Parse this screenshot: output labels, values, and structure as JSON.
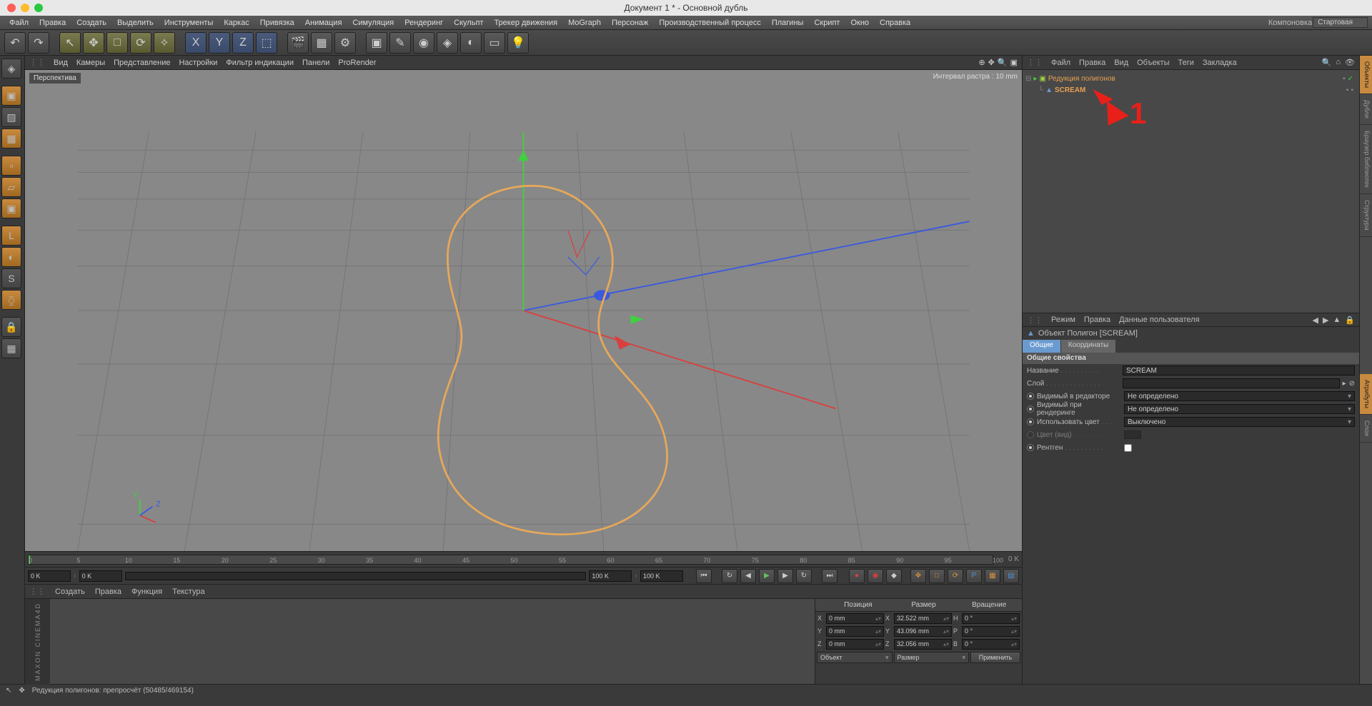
{
  "title": "Документ 1 * - Основной дубль",
  "menu": [
    "Файл",
    "Правка",
    "Создать",
    "Выделить",
    "Инструменты",
    "Каркас",
    "Привязка",
    "Анимация",
    "Симуляция",
    "Рендеринг",
    "Скульпт",
    "Трекер движения",
    "MoGraph",
    "Персонаж",
    "Производственный процесс",
    "Плагины",
    "Скрипт",
    "Окно",
    "Справка"
  ],
  "layout_label": "Компоновка",
  "layout_value": "Стартовая",
  "vp_menu": [
    "Вид",
    "Камеры",
    "Представление",
    "Настройки",
    "Фильтр индикации",
    "Панели",
    "ProRender"
  ],
  "vp_label": "Перспектива",
  "vp_grid": "Интервал растра : 10 mm",
  "timeline": {
    "start": "0 K",
    "end": "100 K",
    "ticks": [
      0,
      5,
      10,
      15,
      20,
      25,
      30,
      35,
      40,
      45,
      50,
      55,
      60,
      65,
      70,
      75,
      80,
      85,
      90,
      95,
      100
    ],
    "endlabel": "0 K"
  },
  "play": {
    "l1": "0 K",
    "l2": "0 K",
    "r1": "100 K",
    "r2": "100 K"
  },
  "mat_menu": [
    "Создать",
    "Правка",
    "Функция",
    "Текстура"
  ],
  "coord": {
    "heads": [
      "Позиция",
      "Размер",
      "Вращение"
    ],
    "rows": [
      {
        "a": "X",
        "p": "0 mm",
        "s": "32.522 mm",
        "ra": "H",
        "r": "0 °"
      },
      {
        "a": "Y",
        "p": "0 mm",
        "s": "43.096 mm",
        "ra": "P",
        "r": "0 °"
      },
      {
        "a": "Z",
        "p": "0 mm",
        "s": "32.056 mm",
        "ra": "B",
        "r": "0 °"
      }
    ],
    "dd1": "Объект",
    "dd2": "Размер",
    "btn": "Применить"
  },
  "obj_menu": [
    "Файл",
    "Правка",
    "Вид",
    "Объекты",
    "Теги",
    "Закладка"
  ],
  "tree": [
    {
      "name": "Редукция полигонов",
      "indent": 0,
      "icon": "gen",
      "sel": false
    },
    {
      "name": "SCREAM",
      "indent": 1,
      "icon": "poly",
      "sel": true
    }
  ],
  "marker1": "1",
  "attr_menu": [
    "Режим",
    "Правка",
    "Данные пользователя"
  ],
  "attr_title": "Объект Полигон [SCREAM]",
  "attr_tabs": [
    "Общие",
    "Координаты"
  ],
  "attr_sec": "Общие свойства",
  "props": {
    "name_l": "Название",
    "name_v": "SCREAM",
    "layer_l": "Слой",
    "layer_v": "",
    "vis_e_l": "Видимый в редакторе",
    "vis_e_v": "Не определено",
    "vis_r_l": "Видимый при рендеринге",
    "vis_r_v": "Не определено",
    "color_l": "Использовать цвет",
    "color_v": "Выключено",
    "colorv_l": "Цвет (вид)",
    "xray_l": "Рентген"
  },
  "rtabs": [
    "Объекты",
    "Дубли",
    "Браузер библиотек",
    "Структура",
    "Атрибуты",
    "Слои"
  ],
  "status": "Редукция полигонов: препросчёт (50485/469154)"
}
